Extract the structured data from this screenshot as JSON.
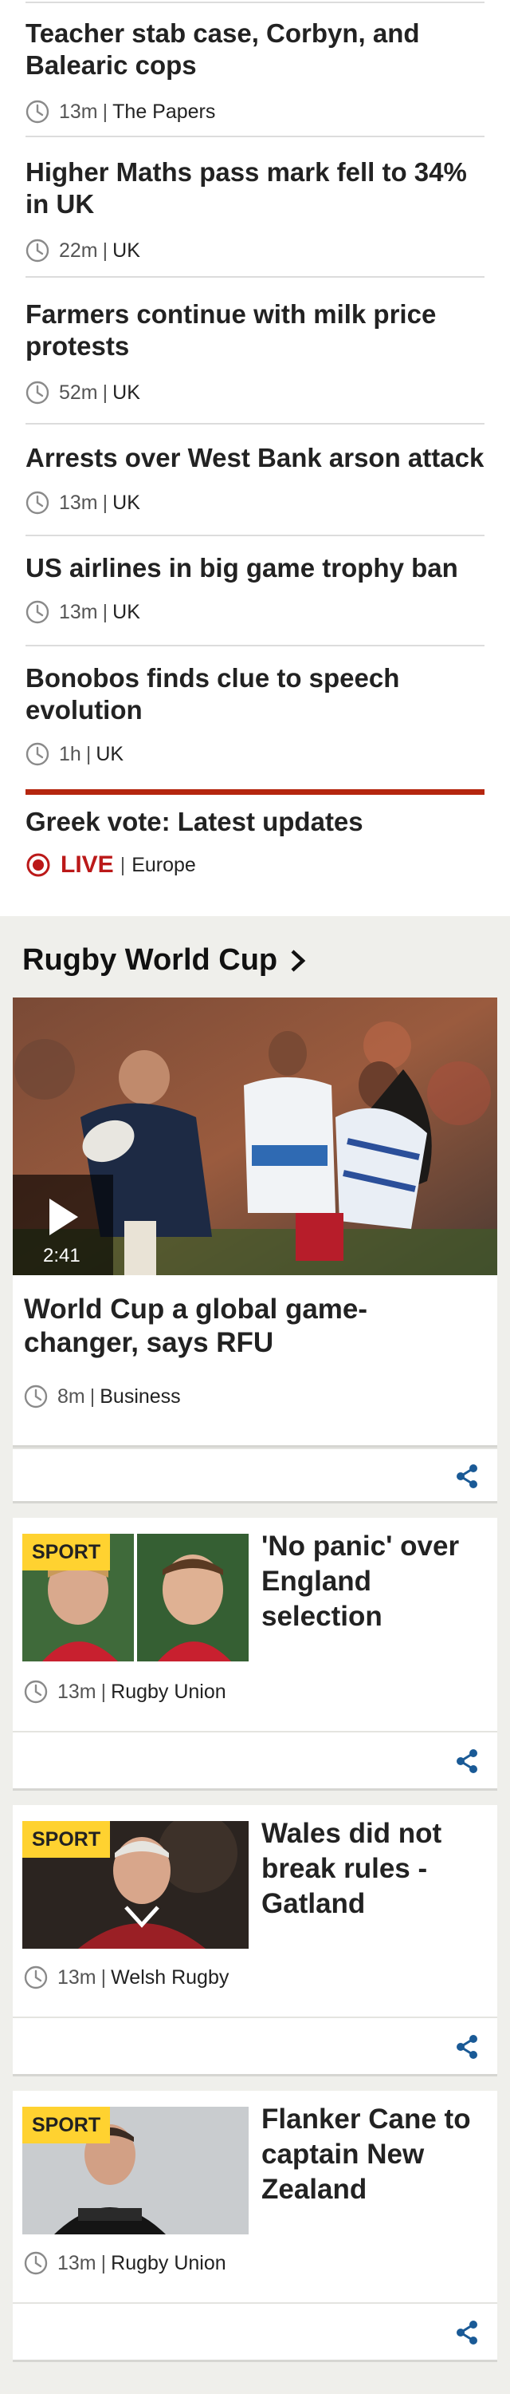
{
  "top_stories": [
    {
      "headline": "Teacher stab case, Corbyn, and Balearic cops",
      "time": "13m",
      "topic": "The Papers"
    },
    {
      "headline": "Higher Maths pass mark fell to 34% in UK",
      "time": "22m",
      "topic": "UK"
    },
    {
      "headline": "Farmers continue with milk price protests",
      "time": "52m",
      "topic": "UK"
    },
    {
      "headline": "Arrests over West Bank arson attack",
      "time": "13m",
      "topic": "UK"
    },
    {
      "headline": "US airlines in big game trophy ban",
      "time": "13m",
      "topic": "UK"
    },
    {
      "headline": "Bonobos finds clue to speech evolution",
      "time": "1h",
      "topic": "UK"
    }
  ],
  "live_story": {
    "headline": "Greek vote: Latest updates",
    "live_label": "LIVE",
    "topic": "Europe"
  },
  "section": {
    "title": "Rugby World Cup",
    "hero": {
      "title": "World Cup a global game-changer, says RFU",
      "duration": "2:41",
      "time": "8m",
      "topic": "Business"
    },
    "cards": [
      {
        "badge": "SPORT",
        "title": "'No panic' over England selection",
        "time": "13m",
        "topic": "Rugby Union"
      },
      {
        "badge": "SPORT",
        "title": "Wales did not break rules - Gatland",
        "time": "13m",
        "topic": "Welsh Rugby"
      },
      {
        "badge": "SPORT",
        "title": "Flanker Cane to captain New Zealand",
        "time": "13m",
        "topic": "Rugby Union"
      }
    ]
  },
  "colors": {
    "live_red": "#bb1919",
    "rule_red": "#b5260f",
    "sport_yellow": "#ffd230",
    "share_blue": "#1a5a96",
    "section_bg": "#efefeb"
  },
  "icons": {
    "clock": "clock-icon",
    "share": "share-icon",
    "play": "play-icon",
    "chevron": "chevron-right-icon",
    "live": "live-dot-icon"
  }
}
